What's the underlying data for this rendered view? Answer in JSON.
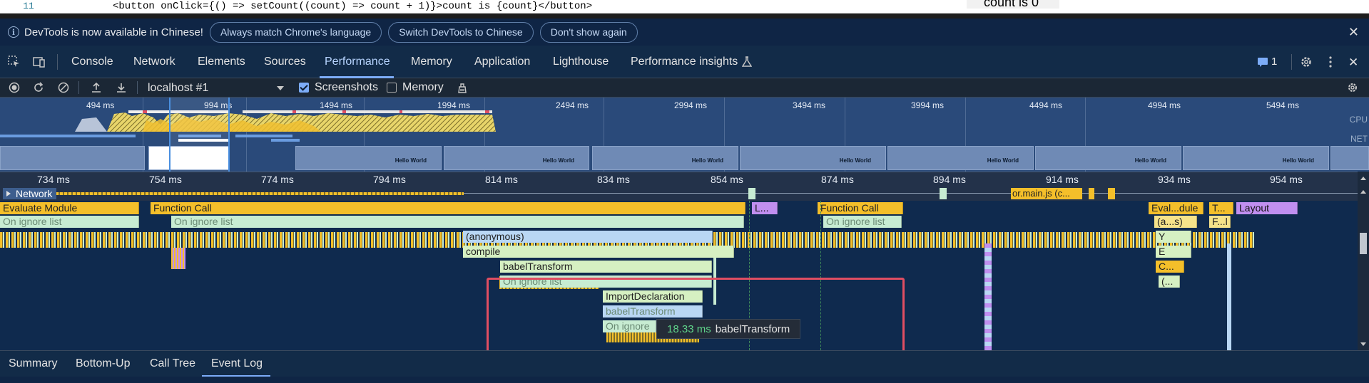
{
  "editor": {
    "line_number": "11",
    "code_line": "<button onClick={() => setCount((count) => count + 1)}>count is {count}</button>",
    "preview_text": "count is 0"
  },
  "infobar": {
    "message": "DevTools is now available in Chinese!",
    "buttons": [
      "Always match Chrome's language",
      "Switch DevTools to Chinese",
      "Don't show again"
    ],
    "close_glyph": "✕"
  },
  "tabs": {
    "items": [
      "Console",
      "Network",
      "Elements",
      "Sources",
      "Performance",
      "Memory",
      "Application",
      "Lighthouse",
      "Performance insights"
    ],
    "active": "Performance",
    "issues_count": "1",
    "settings_icon": "gear-icon",
    "more_icon": "kebab-icon",
    "close_glyph": "✕"
  },
  "perf_toolbar": {
    "target": "localhost #1",
    "screenshots_label": "Screenshots",
    "screenshots_checked": true,
    "memory_label": "Memory",
    "memory_checked": false
  },
  "overview": {
    "ticks": [
      "494 ms",
      "994 ms",
      "1494 ms",
      "1994 ms",
      "2494 ms",
      "2994 ms",
      "3494 ms",
      "3994 ms",
      "4494 ms",
      "4994 ms",
      "5494 ms"
    ],
    "cpu_label": "CPU",
    "net_label": "NET",
    "thumbnail_text": "Hello World"
  },
  "ruler": {
    "ticks": [
      "734 ms",
      "754 ms",
      "774 ms",
      "794 ms",
      "814 ms",
      "834 ms",
      "854 ms",
      "874 ms",
      "894 ms",
      "914 ms",
      "934 ms",
      "954 ms"
    ]
  },
  "network_track": {
    "label": "Network",
    "request_label": "or.main.js (c..."
  },
  "flame": {
    "row0": [
      "Evaluate Module",
      "Function Call",
      "L...",
      "Function Call",
      "Eval...dule",
      "T...",
      "Layout"
    ],
    "row1": [
      "On ignore list",
      "On ignore list",
      "On ignore list",
      "(a...s)",
      "F...l"
    ],
    "row2": [
      "(anonymous)",
      "Y"
    ],
    "row3": [
      "compile",
      "E"
    ],
    "row4": [
      "babelTransform",
      "C..."
    ],
    "row5": [
      "On ignore list",
      "(..."
    ],
    "row6": [
      "ImportDeclaration"
    ],
    "row7": [
      "babelTransform"
    ],
    "row8": [
      "On ignore"
    ]
  },
  "tooltip": {
    "duration": "18.33 ms",
    "name": "babelTransform"
  },
  "bottom_tabs": {
    "items": [
      "Summary",
      "Bottom-Up",
      "Call Tree",
      "Event Log"
    ],
    "active": "Event Log"
  },
  "colors": {
    "accent": "#7cacf8",
    "scripting": "#f4bf2a",
    "highlight": "#e04e62"
  }
}
